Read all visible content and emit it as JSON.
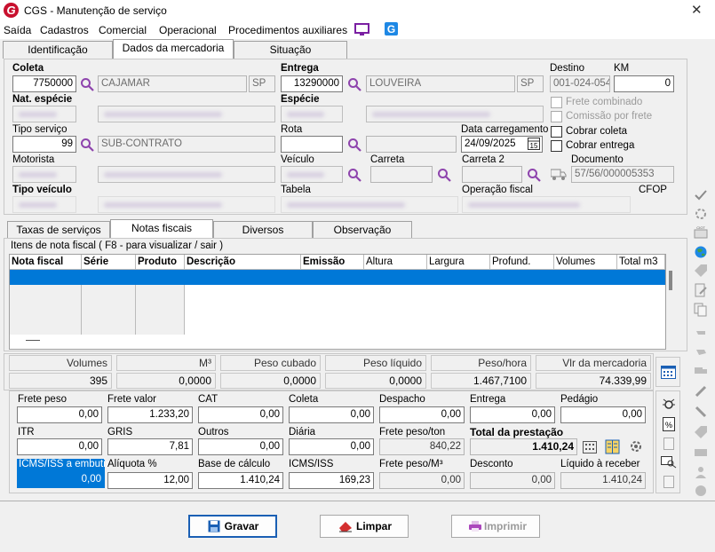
{
  "window": {
    "title": "CGS - Manutenção de serviço",
    "logo_letter": "G"
  },
  "menu": [
    "Saída",
    "Cadastros",
    "Comercial",
    "Operacional",
    "Procedimentos auxiliares"
  ],
  "top_tabs": [
    "Identificação",
    "Dados da mercadoria",
    "Situação"
  ],
  "form": {
    "coleta_label": "Coleta",
    "coleta_value": "7750000",
    "coleta_city": "CAJAMAR",
    "coleta_uf": "SP",
    "entrega_label": "Entrega",
    "entrega_value": "13290000",
    "entrega_city": "LOUVEIRA",
    "entrega_uf": "SP",
    "destino_label": "Destino",
    "destino_value": "001-024-054",
    "km_label": "KM",
    "km_value": "0",
    "nat_especie_label": "Nat. espécie",
    "especie_label": "Espécie",
    "frete_combinado": "Frete combinado",
    "comissao_frete": "Comissão por frete",
    "tipo_servico_label": "Tipo serviço",
    "tipo_servico_value": "99",
    "tipo_servico_desc": "SUB-CONTRATO",
    "rota_label": "Rota",
    "data_carregamento_label": "Data carregamento",
    "data_carregamento_value": "24/09/2025",
    "cobrar_coleta": "Cobrar coleta",
    "cobrar_entrega": "Cobrar entrega",
    "motorista_label": "Motorista",
    "veiculo_label": "Veículo",
    "carreta_label": "Carreta",
    "carreta2_label": "Carreta 2",
    "documento_label": "Documento",
    "documento_value": "57/56/000005353",
    "tipo_veiculo_label": "Tipo veículo",
    "tabela_label": "Tabela",
    "operacao_fiscal_label": "Operação fiscal",
    "cfop_label": "CFOP"
  },
  "sub_tabs": [
    "Taxas de serviços",
    "Notas fiscais",
    "Diversos",
    "Observação"
  ],
  "grid": {
    "group_title": "Itens de nota fiscal ( F8 - para visualizar / sair )",
    "columns": [
      "Nota fiscal",
      "Série",
      "Produto",
      "Descrição",
      "Emissão",
      "Altura",
      "Largura",
      "Profund.",
      "Volumes",
      "Total m3"
    ]
  },
  "totals": {
    "headers": [
      "Volumes",
      "M³",
      "Peso cubado",
      "Peso líquido",
      "Peso/hora",
      "Vlr da mercadoria"
    ],
    "values": [
      "395",
      "0,0000",
      "0,0000",
      "0,0000",
      "1.467,7100",
      "74.339,99"
    ]
  },
  "freight": {
    "row1": [
      {
        "label": "Frete peso",
        "value": "0,00"
      },
      {
        "label": "Frete valor",
        "value": "1.233,20"
      },
      {
        "label": "CAT",
        "value": "0,00"
      },
      {
        "label": "Coleta",
        "value": "0,00"
      },
      {
        "label": "Despacho",
        "value": "0,00"
      },
      {
        "label": "Entrega",
        "value": "0,00"
      },
      {
        "label": "Pedágio",
        "value": "0,00"
      }
    ],
    "row2": [
      {
        "label": "ITR",
        "value": "0,00"
      },
      {
        "label": "GRIS",
        "value": "7,81"
      },
      {
        "label": "Outros",
        "value": "0,00"
      },
      {
        "label": "Diária",
        "value": "0,00"
      },
      {
        "label": "Frete peso/ton",
        "value": "840,22"
      }
    ],
    "total_label": "Total da prestação",
    "total_value": "1.410,24",
    "row3": [
      {
        "label": "ICMS/ISS a embutir",
        "value": "0,00"
      },
      {
        "label": "Alíquota %",
        "value": "12,00"
      },
      {
        "label": "Base de cálculo",
        "value": "1.410,24"
      },
      {
        "label": "ICMS/ISS",
        "value": "169,23"
      },
      {
        "label": "Frete peso/M³",
        "value": "0,00"
      },
      {
        "label": "Desconto",
        "value": "0,00"
      },
      {
        "label": "Líquido à receber",
        "value": "1.410,24"
      }
    ]
  },
  "buttons": {
    "save": "Gravar",
    "clear": "Limpar",
    "print": "Imprimir"
  },
  "colors": {
    "accent": "#0078d7",
    "logo": "#c8102e",
    "magnifier": "#8e44ad"
  }
}
